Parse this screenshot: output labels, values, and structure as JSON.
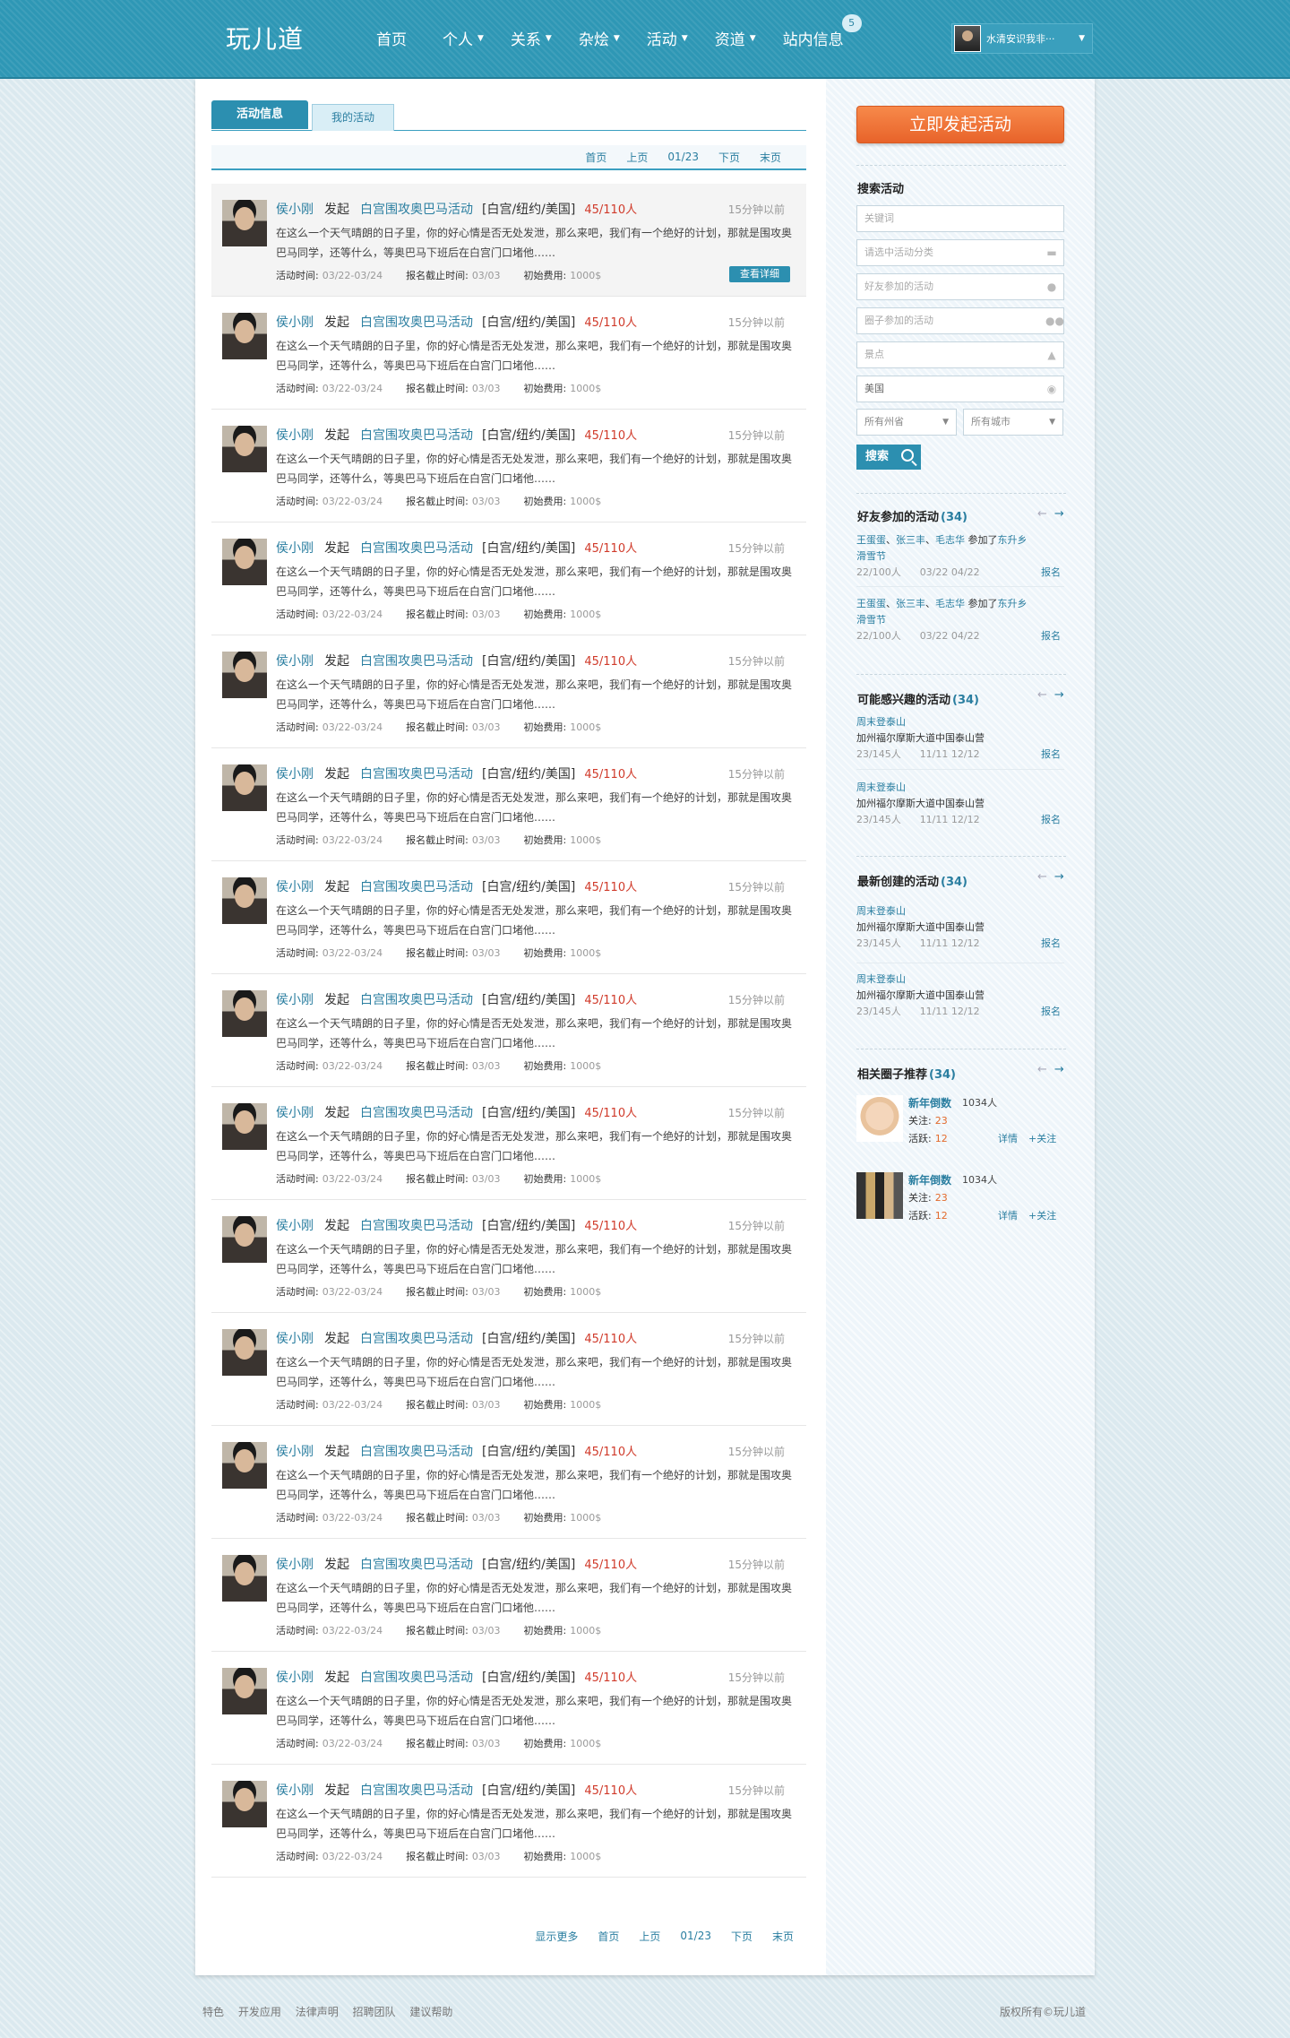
{
  "header": {
    "logo": "玩儿道",
    "nav": [
      {
        "label": "首页",
        "caret": false
      },
      {
        "label": "个人",
        "caret": true
      },
      {
        "label": "关系",
        "caret": true
      },
      {
        "label": "杂烩",
        "caret": true
      },
      {
        "label": "活动",
        "caret": true
      },
      {
        "label": "资道",
        "caret": true
      },
      {
        "label": "站内信息",
        "caret": false,
        "badge": "5"
      }
    ],
    "user_name": "水清安识我非···"
  },
  "tabs": {
    "active": "活动信息",
    "inactive": "我的活动"
  },
  "pager": {
    "first": "首页",
    "prev": "上页",
    "page": "01/23",
    "next": "下页",
    "last": "末页",
    "more": "显示更多"
  },
  "feed": {
    "author": "侯小刚",
    "verb": "发起",
    "event_title": "白宫围攻奥巴马活动",
    "place": "[白宫/纽约/美国]",
    "count": "45/110人",
    "time": "15分钟以前",
    "desc": "在这么一个天气晴朗的日子里，你的好心情是否无处发泄，那么来吧，我们有一个绝好的计划，那就是围攻奥巴马同学，还等什么，等奥巴马下班后在白宫门口堵他……",
    "time_label": "活动时间:",
    "time_value": "03/22-03/24",
    "deadline_label": "报名截止时间:",
    "deadline_value": "03/03",
    "fee_label": "初始费用:",
    "fee_value": "1000$",
    "detail_button": "查看详细",
    "items": 15
  },
  "sidebar": {
    "launch_button": "立即发起活动",
    "search": {
      "title": "搜索活动",
      "keyword_placeholder": "关键词",
      "category_placeholder": "请选中活动分类",
      "friends_placeholder": "好友参加的活动",
      "circle_placeholder": "圈子参加的活动",
      "spot_placeholder": "景点",
      "country_value": "美国",
      "state_select": "所有州省",
      "city_select": "所有城市",
      "button": "搜索"
    },
    "friends": {
      "title": "好友参加的活动",
      "count": "(34)",
      "entries": [
        {
          "n1": "王蛋蛋",
          "n2": "张三丰",
          "n3": "毛志华",
          "joined": "参加了",
          "event1": "东升乡",
          "event2": "滑雪节",
          "people": "22/100人",
          "date": "03/22 04/22",
          "signup": "报名"
        },
        {
          "n1": "王蛋蛋",
          "n2": "张三丰",
          "n3": "毛志华",
          "joined": "参加了",
          "event1": "东升乡",
          "event2": "滑雪节",
          "people": "22/100人",
          "date": "03/22 04/22",
          "signup": "报名"
        }
      ]
    },
    "interest": {
      "title": "可能感兴趣的活动",
      "count": "(34)",
      "entries": [
        {
          "name": "周末登泰山",
          "place": "加州福尔摩斯大道中国泰山营",
          "people": "23/145人",
          "date": "11/11 12/12",
          "signup": "报名"
        },
        {
          "name": "周末登泰山",
          "place": "加州福尔摩斯大道中国泰山营",
          "people": "23/145人",
          "date": "11/11 12/12",
          "signup": "报名"
        }
      ]
    },
    "newest": {
      "title": "最新创建的活动",
      "count": "(34)",
      "entries": [
        {
          "name": "周末登泰山",
          "place": "加州福尔摩斯大道中国泰山营",
          "people": "23/145人",
          "date": "11/11 12/12",
          "signup": "报名"
        },
        {
          "name": "周末登泰山",
          "place": "加州福尔摩斯大道中国泰山营",
          "people": "23/145人",
          "date": "11/11 12/12",
          "signup": "报名"
        }
      ]
    },
    "circles": {
      "title": "相关圈子推荐",
      "count": "(34)",
      "entries": [
        {
          "name": "新年倒数",
          "members": "1034人",
          "follow_label": "关注:",
          "follow_val": "23",
          "active_label": "活跃:",
          "active_val": "12",
          "detail": "详情",
          "follow": "+关注"
        },
        {
          "name": "新年倒数",
          "members": "1034人",
          "follow_label": "关注:",
          "follow_val": "23",
          "active_label": "活跃:",
          "active_val": "12",
          "detail": "详情",
          "follow": "+关注"
        }
      ]
    }
  },
  "footer": {
    "links": [
      "特色",
      "开发应用",
      "法律声明",
      "招聘团队",
      "建议帮助"
    ],
    "copyright": "版权所有©玩儿道"
  }
}
